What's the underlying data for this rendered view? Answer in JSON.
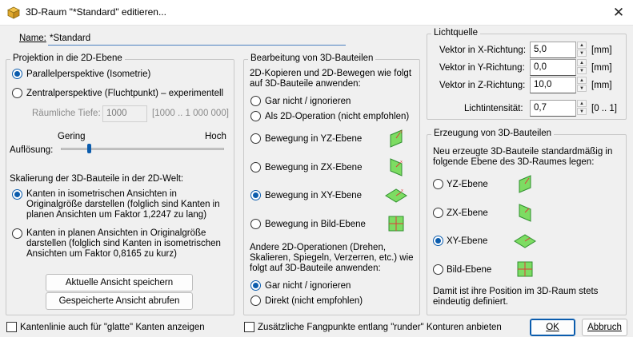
{
  "window": {
    "title": "3D-Raum \"*Standard\" editieren...",
    "icon": "cube-icon",
    "close_glyph": "✕"
  },
  "name": {
    "label": "Name:",
    "value": "*Standard"
  },
  "projection": {
    "legend": "Projektion in die 2D-Ebene",
    "option_parallel": "Parallelperspektive (Isometrie)",
    "option_central": "Zentralperspektive (Fluchtpunkt) – experimentell",
    "selected": "parallel",
    "depth_label": "Räumliche Tiefe:",
    "depth_value": "1000",
    "depth_range": "[1000 .. 1 000 000]",
    "resolution_low": "Gering",
    "resolution_high": "Hoch",
    "resolution_label": "Auflösung:",
    "resolution_fraction": 0.17,
    "scaling_title": "Skalierung der 3D-Bauteile in der 2D-Welt:",
    "scaling_iso": "Kanten in isometrischen Ansichten in Originalgröße darstellen (folglich sind Kanten in planen Ansichten um Faktor 1,2247 zu lang)",
    "scaling_plan": "Kanten in planen Ansichten in Originalgröße darstellen (folglich sind Kanten in isometrischen Ansichten um Faktor 0,8165 zu kurz)",
    "scaling_selected": "iso",
    "save_view": "Aktuelle Ansicht speichern",
    "load_view": "Gespeicherte Ansicht abrufen"
  },
  "editing": {
    "legend": "Bearbeitung von 3D-Bauteilen",
    "intro": "2D-Kopieren und 2D-Bewegen wie folgt auf 3D-Bauteile anwenden:",
    "options": [
      "Gar nicht / ignorieren",
      "Als 2D-Operation (nicht empfohlen)",
      "Bewegung in YZ-Ebene",
      "Bewegung in ZX-Ebene",
      "Bewegung in XY-Ebene",
      "Bewegung in Bild-Ebene"
    ],
    "selected_index": 4,
    "other_intro": "Andere 2D-Operationen (Drehen, Skalieren, Spiegeln, Verzerren, etc.) wie folgt auf 3D-Bauteile anwenden:",
    "other_options": [
      "Gar nicht / ignorieren",
      "Direkt (nicht empfohlen)"
    ],
    "other_selected_index": 0
  },
  "light": {
    "legend": "Lichtquelle",
    "x_label": "Vektor in X-Richtung:",
    "x_value": "5,0",
    "y_label": "Vektor in Y-Richtung:",
    "y_value": "0,0",
    "z_label": "Vektor in Z-Richtung:",
    "z_value": "10,0",
    "unit": "[mm]",
    "intensity_label": "Lichtintensität:",
    "intensity_value": "0,7",
    "intensity_range": "[0 .. 1]"
  },
  "creation": {
    "legend": "Erzeugung von 3D-Bauteilen",
    "intro": "Neu erzeugte 3D-Bauteile standardmäßig in folgende Ebene des 3D-Raumes legen:",
    "options": [
      "YZ-Ebene",
      "ZX-Ebene",
      "XY-Ebene",
      "Bild-Ebene"
    ],
    "selected_index": 2,
    "footer": "Damit ist ihre Position im 3D-Raum stets eindeutig definiert."
  },
  "bottom": {
    "edge_checkbox": "Kantenlinie auch für \"glatte\" Kanten anzeigen",
    "snap_checkbox": "Zusätzliche Fangpunkte entlang \"runder\" Konturen anbieten",
    "ok": "OK",
    "cancel": "Abbruch"
  },
  "colors": {
    "accent": "#0b5cad",
    "plane_fill": "#7ddc62",
    "plane_stroke": "#2f8f2f",
    "axis_red": "#e03a3a"
  }
}
